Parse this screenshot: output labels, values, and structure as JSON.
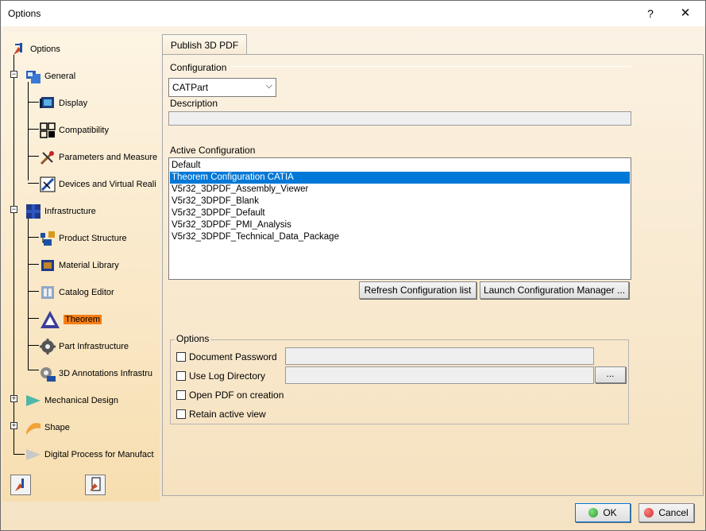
{
  "window": {
    "title": "Options",
    "help_label": "?",
    "close_label": "✕"
  },
  "tree": {
    "items": [
      {
        "label": "Options",
        "icon": "options-icon"
      },
      {
        "label": "General",
        "icon": "general-icon"
      },
      {
        "label": "Display",
        "icon": "display-icon"
      },
      {
        "label": "Compatibility",
        "icon": "compatibility-icon"
      },
      {
        "label": "Parameters and Measure",
        "icon": "parameters-icon"
      },
      {
        "label": "Devices and Virtual Reali",
        "icon": "devices-icon"
      },
      {
        "label": "Infrastructure",
        "icon": "infrastructure-icon"
      },
      {
        "label": "Product Structure",
        "icon": "product-structure-icon"
      },
      {
        "label": "Material Library",
        "icon": "material-library-icon"
      },
      {
        "label": "Catalog Editor",
        "icon": "catalog-editor-icon"
      },
      {
        "label": "Theorem",
        "icon": "theorem-icon"
      },
      {
        "label": "Part Infrastructure",
        "icon": "gear-icon"
      },
      {
        "label": "3D Annotations Infrastru",
        "icon": "3d-annotations-icon"
      },
      {
        "label": "Mechanical Design",
        "icon": "mechanical-design-icon"
      },
      {
        "label": "Shape",
        "icon": "shape-icon"
      },
      {
        "label": "Digital Process for Manufact",
        "icon": "digital-process-icon"
      }
    ],
    "selected": "Theorem"
  },
  "tab": {
    "label": "Publish 3D PDF"
  },
  "configuration": {
    "section_label": "Configuration",
    "selected": "CATPart",
    "description_label": "Description",
    "description_value": ""
  },
  "active_configuration": {
    "label": "Active Configuration",
    "items": [
      "Default",
      "Theorem Configuration CATIA",
      "V5r32_3DPDF_Assembly_Viewer",
      "V5r32_3DPDF_Blank",
      "V5r32_3DPDF_Default",
      "V5r32_3DPDF_PMI_Analysis",
      "V5r32_3DPDF_Technical_Data_Package"
    ],
    "selected_item": "Theorem Configuration CATIA",
    "refresh_label": "Refresh Configuration list",
    "launch_label": "Launch Configuration Manager ..."
  },
  "options": {
    "title": "Options",
    "document_password": "Document Password",
    "use_log_directory": "Use Log Directory",
    "browse_label": "...",
    "open_pdf": "Open PDF on creation",
    "retain_view": "Retain active view"
  },
  "footer": {
    "ok_label": "OK",
    "cancel_label": "Cancel"
  },
  "colors": {
    "selection": "#0078d7",
    "tree_selection": "#f57f17",
    "ok_dot": "#2e9e2e",
    "cancel_dot": "#c92a2a"
  }
}
